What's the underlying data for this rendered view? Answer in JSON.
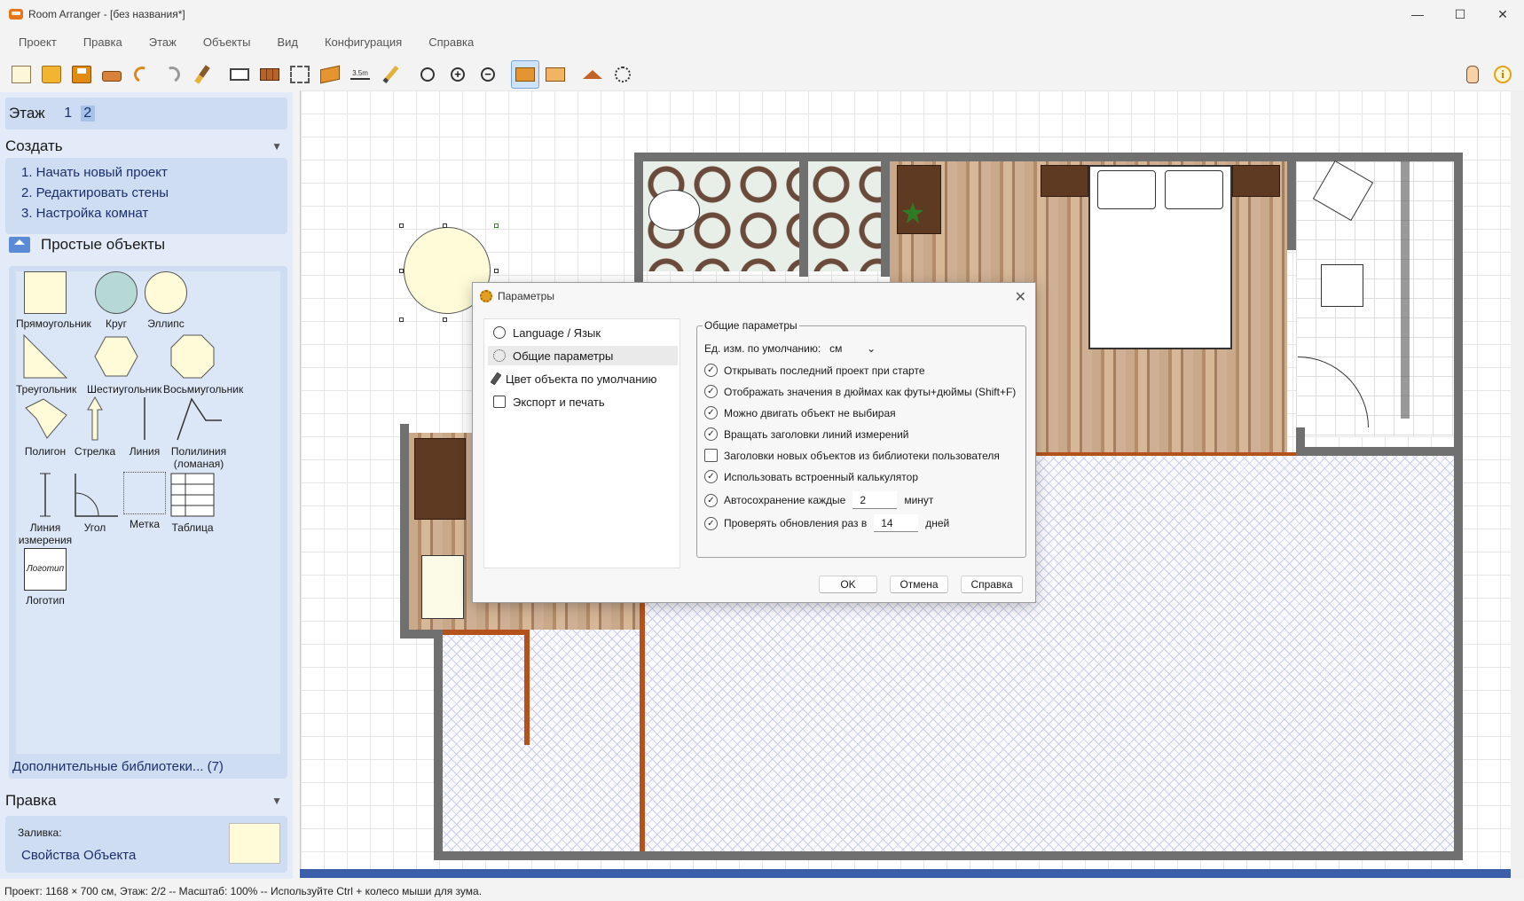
{
  "window": {
    "title": "Room Arranger - [без названия*]",
    "controls": {
      "minimize": "—",
      "maximize": "☐",
      "close": "✕"
    }
  },
  "menu": [
    "Проект",
    "Правка",
    "Этаж",
    "Объекты",
    "Вид",
    "Конфигурация",
    "Справка"
  ],
  "toolbar": {
    "dimension_label": "3.5m",
    "zoom_in_glyph": "+",
    "zoom_out_glyph": "−",
    "info_glyph": "i"
  },
  "left_panel": {
    "floor_label": "Этаж",
    "floors": [
      "1",
      "2"
    ],
    "selected_floor": "2",
    "create_header": "Создать",
    "create_items": [
      "1. Начать новый проект",
      "2. Редактировать стены",
      "3. Настройка комнат"
    ],
    "simple_objects_header": "Простые объекты",
    "objects": [
      "Прямоугольник",
      "Круг",
      "Эллипс",
      "Треугольник",
      "Шестиугольник",
      "Восьмиугольник",
      "Полигон",
      "Стрелка",
      "Линия",
      "Полилиния (ломаная)",
      "Линия измерения",
      "Угол",
      "Метка",
      "Таблица",
      "Логотип"
    ],
    "logo_text": "Логотип",
    "more_libraries": "Дополнительные библиотеки... (7)",
    "edit_header": "Правка",
    "fill_label": "Заливка:",
    "object_properties": "Свойства Объекта",
    "fill_color": "#fffbd9",
    "collapse_glyph": "▼"
  },
  "dialog": {
    "title": "Параметры",
    "close_glyph": "✕",
    "nav": [
      "Language / Язык",
      "Общие параметры",
      "Цвет объекта по умолчанию",
      "Экспорт и печать"
    ],
    "selected_nav": "Общие параметры",
    "group_title": "Общие параметры",
    "unit_label": "Ед. изм. по умолчанию:",
    "unit_value": "см",
    "unit_arrow": "⌄",
    "options": [
      {
        "label": "Открывать последний проект при старте",
        "checked": true
      },
      {
        "label": "Отображать значения в дюймах как футы+дюймы (Shift+F)",
        "checked": true
      },
      {
        "label": "Можно двигать объект не выбирая",
        "checked": true
      },
      {
        "label": "Вращать заголовки линий измерений",
        "checked": true
      },
      {
        "label": "Заголовки новых объектов из библиотеки пользователя",
        "checked": false
      },
      {
        "label": "Использовать встроенный калькулятор",
        "checked": true
      }
    ],
    "autosave_label": "Автосохранение каждые",
    "autosave_value": "2",
    "autosave_unit": "минут",
    "update_label": "Проверять обновления раз в",
    "update_value": "14",
    "update_unit": "дней",
    "check_glyph": "✓",
    "buttons": {
      "ok": "OK",
      "cancel": "Отмена",
      "help": "Справка"
    }
  },
  "status_bar": "Проект: 1168 × 700 см, Этаж: 2/2 -- Масштаб: 100% -- Используйте Ctrl + колесо мыши для зума.",
  "colors": {
    "accent_panel": "#cfddf3",
    "wall": "#707070",
    "door_wall": "#b5521c"
  }
}
